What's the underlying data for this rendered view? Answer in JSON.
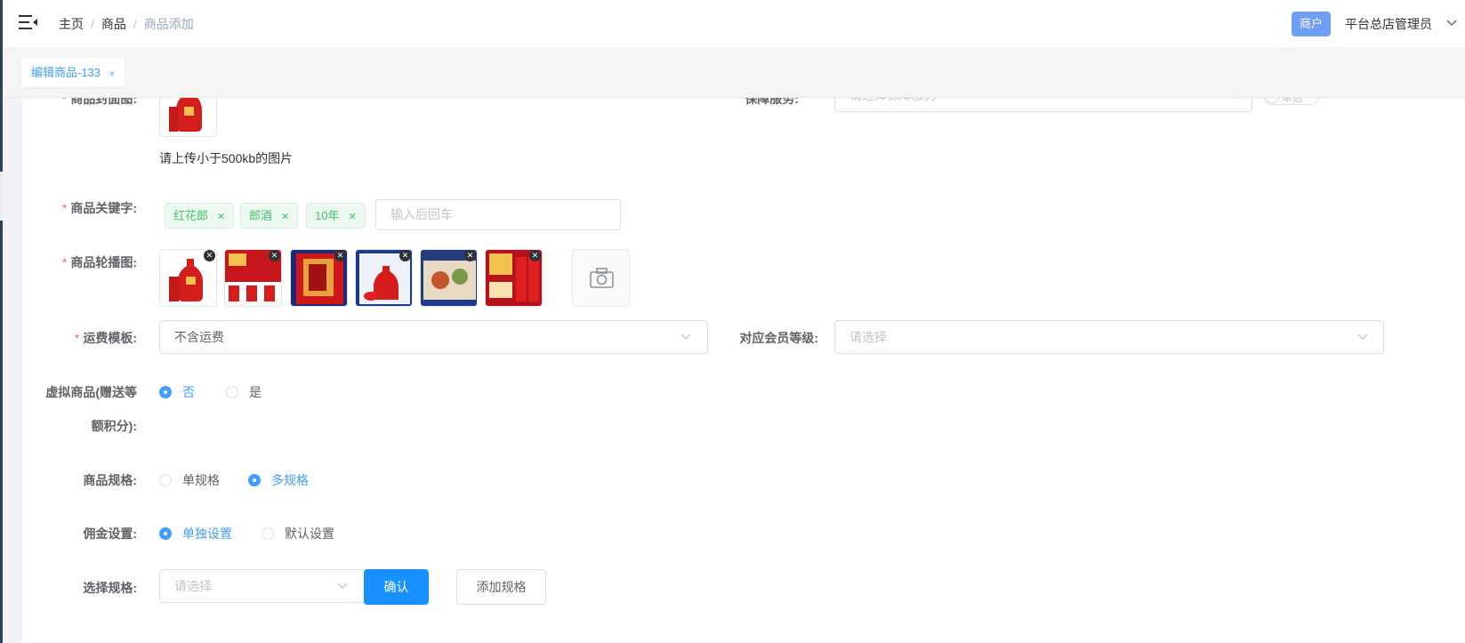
{
  "header": {
    "breadcrumb": [
      "主页",
      "商品",
      "商品添加"
    ],
    "separator": "/",
    "merchant_badge": "商户",
    "admin_name": "平台总店管理员"
  },
  "tabs": [
    {
      "label": "编辑商品-133",
      "close": "×"
    }
  ],
  "form": {
    "cover": {
      "label": "商品封面图:",
      "hint": "请上传小于500kb的图片"
    },
    "guarantee": {
      "label": "保障服务:",
      "placeholder": "请选择保障服务",
      "switch_text": "单选"
    },
    "keywords": {
      "label": "商品关键字:",
      "tags": [
        "红花郎",
        "郎酒",
        "10年"
      ],
      "placeholder": "输入后回车"
    },
    "carousel": {
      "label": "商品轮播图:",
      "image_count": 6
    },
    "shipping": {
      "label": "运费模板:",
      "value": "不含运费"
    },
    "member_level": {
      "label": "对应会员等级:",
      "placeholder": "请选择"
    },
    "virtual": {
      "label_line1": "虚拟商品(赠送等",
      "label_line2": "额积分):",
      "options": [
        "否",
        "是"
      ],
      "selected": "否"
    },
    "spec": {
      "label": "商品规格:",
      "options": [
        "单规格",
        "多规格"
      ],
      "selected": "多规格"
    },
    "commission": {
      "label": "佣金设置:",
      "options": [
        "单独设置",
        "默认设置"
      ],
      "selected": "单独设置"
    },
    "choose_spec": {
      "label": "选择规格:",
      "placeholder": "请选择",
      "confirm": "确认",
      "add": "添加规格"
    }
  },
  "colors": {
    "primary": "#409eff",
    "danger": "#f56c6c",
    "success": "#40c66a",
    "badge": "#6f9ef5"
  }
}
